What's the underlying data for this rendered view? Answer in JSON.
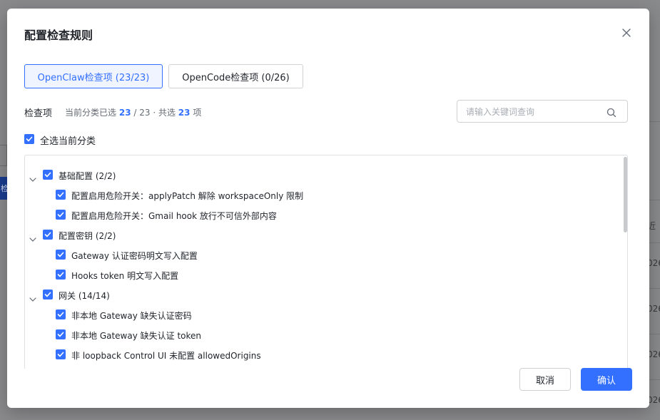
{
  "dialog": {
    "title": "配置检查规则",
    "tabs": [
      {
        "label": "OpenClaw检查项 (23/23)",
        "active": true
      },
      {
        "label": "OpenCode检查项 (0/26)",
        "active": false
      }
    ],
    "section_label": "检查项",
    "summary": {
      "prefix": "当前分类已选",
      "selected": "23",
      "middle": "/ 23 · 共选",
      "total": "23",
      "suffix": "项"
    },
    "search": {
      "placeholder": "请输入关键词查询",
      "value": ""
    },
    "select_all_label": "全选当前分类",
    "tree": [
      {
        "label": "基础配置 (2/2)",
        "checked": true,
        "expanded": true,
        "children": [
          {
            "label": "配置启用危险开关：applyPatch 解除 workspaceOnly 限制",
            "checked": true
          },
          {
            "label": "配置启用危险开关：Gmail hook 放行不可信外部内容",
            "checked": true
          }
        ]
      },
      {
        "label": "配置密钥 (2/2)",
        "checked": true,
        "expanded": true,
        "children": [
          {
            "label": "Gateway 认证密码明文写入配置",
            "checked": true
          },
          {
            "label": "Hooks token 明文写入配置",
            "checked": true
          }
        ]
      },
      {
        "label": "网关 (14/14)",
        "checked": true,
        "expanded": true,
        "children": [
          {
            "label": "非本地 Gateway 缺失认证密码",
            "checked": true
          },
          {
            "label": "非本地 Gateway 缺失认证 token",
            "checked": true
          },
          {
            "label": "非 loopback Control UI 未配置 allowedOrigins",
            "checked": true
          }
        ]
      }
    ],
    "buttons": {
      "cancel": "取消",
      "confirm": "确认"
    }
  },
  "background": {
    "fragments": [
      "检",
      "近",
      "026",
      "026",
      "026",
      "026"
    ]
  },
  "colors": {
    "accent": "#3370ff",
    "text": "#1f2329",
    "muted": "#646a73",
    "border": "#d0d3d6"
  }
}
